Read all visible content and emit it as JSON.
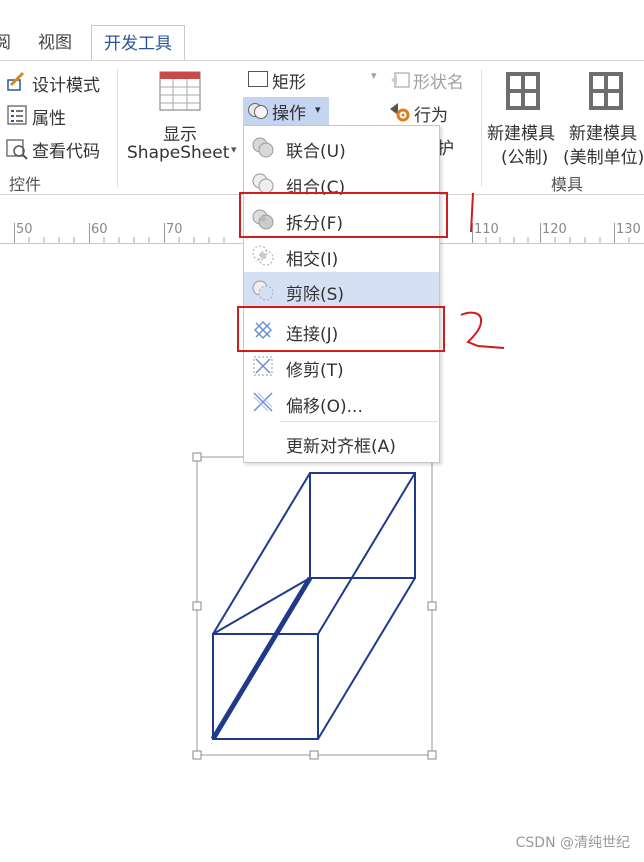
{
  "tabs": {
    "partial": "阅",
    "view": "视图",
    "developer": "开发工具"
  },
  "ribbon": {
    "design_mode": "设计模式",
    "properties": "属性",
    "view_code": "查看代码",
    "controls_group": "控件",
    "show_label": "显示",
    "shapesheet_label": "ShapeSheet",
    "rectangle": "矩形",
    "operations": "操作",
    "shape_name": "形状名",
    "behavior": "行为",
    "protect_partial": "护",
    "new_stencil_metric_line1": "新建模具",
    "new_stencil_metric_line2": "(公制)",
    "new_stencil_us_line1": "新建模具",
    "new_stencil_us_line2": "(美制单位)",
    "stencil_group": "模具"
  },
  "ruler": {
    "labels": [
      "50",
      "60",
      "70",
      "110",
      "120",
      "130"
    ]
  },
  "menu": {
    "items": [
      {
        "label": "联合(U)",
        "icon": "union-icon"
      },
      {
        "label": "组合(C)",
        "icon": "combine-icon"
      },
      {
        "label": "拆分(F)",
        "icon": "fragment-icon"
      },
      {
        "label": "相交(I)",
        "icon": "intersect-icon"
      },
      {
        "label": "剪除(S)",
        "icon": "subtract-icon"
      },
      {
        "label": "连接(J)",
        "icon": "join-icon"
      },
      {
        "label": "修剪(T)",
        "icon": "trim-icon"
      },
      {
        "label": "偏移(O)...",
        "icon": "offset-icon"
      },
      {
        "label": "更新对齐框(A)",
        "icon": ""
      }
    ],
    "highlighted_index": 4
  },
  "annotations": {
    "mark_one": "1",
    "mark_two": "2"
  },
  "watermark": "CSDN @清纯世纪",
  "colors": {
    "accent": "#2b579a",
    "highlight": "#d6e0f5",
    "shape_stroke": "#1f3a8a",
    "annotation_red": "#d01c1c"
  }
}
